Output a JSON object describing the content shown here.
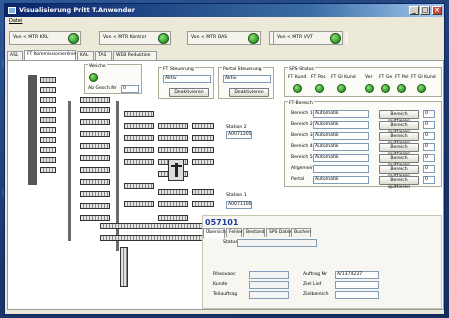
{
  "window": {
    "title": "Visualisierung Pritt T.Anwender",
    "menu_label": "Datei",
    "minimize_glyph": "_",
    "maximize_glyph": "□",
    "close_glyph": "×"
  },
  "status_strip": [
    {
      "label": "Von < MTR KRL"
    },
    {
      "label": "Von < MTR Kontrol"
    },
    {
      "label": "Von < MTR DAS"
    },
    {
      "label": "Von < MTR TDA"
    },
    {
      "label": "Von < MTR VVT"
    }
  ],
  "tabs": [
    {
      "label": "ASL",
      "active": false
    },
    {
      "label": "FT Kommissionierlinie",
      "active": true
    },
    {
      "label": "KAL",
      "active": false
    },
    {
      "label": "TAS",
      "active": false
    },
    {
      "label": "WEB Reduktion",
      "active": false
    }
  ],
  "weiche": {
    "title": "Weiche",
    "label": "Ab Gesch.Nr",
    "value": "0"
  },
  "ft_steuerung": {
    "title": "FT Steuerung",
    "field": "Aktiv",
    "button": "Deaktivieren"
  },
  "portal_steuerung": {
    "title": "Portal Steuerung",
    "field": "Aktiv",
    "button": "Deaktivieren"
  },
  "sps_status": {
    "title": "SPS-Status",
    "items": [
      "FT Kund",
      "FT Pos",
      "FT Gl Kund",
      "Ver",
      "FT Ge",
      "FT Pel",
      "FT Gl Kund"
    ]
  },
  "ft_bereich": {
    "title": "FT-Bereich",
    "rows": [
      {
        "label": "Bereich 1",
        "mode": "Automatik",
        "button": "Bereich quittieren",
        "value": "0"
      },
      {
        "label": "Bereich 2",
        "mode": "Automatik",
        "button": "Bereich quittieren",
        "value": "0"
      },
      {
        "label": "Bereich 3",
        "mode": "Automatik",
        "button": "Bereich quittieren",
        "value": "0"
      },
      {
        "label": "Bereich 4",
        "mode": "Automatik",
        "button": "Bereich quittieren",
        "value": "0"
      },
      {
        "label": "Bereich 5",
        "mode": "Automatik",
        "button": "Bereich quittieren",
        "value": "0"
      },
      {
        "label": "Allgemein",
        "mode": "",
        "button": "Bereich quittieren",
        "value": "0"
      },
      {
        "label": "Portal",
        "mode": "Automatik",
        "button": "Bereich quittieren",
        "value": "0"
      }
    ]
  },
  "stations": [
    {
      "label": "Station 2",
      "value": "A0071205"
    },
    {
      "label": "Station 1",
      "value": "A0071100"
    }
  ],
  "detail": {
    "order_number": "057101",
    "tabs": [
      "Übersicht",
      "Fehler",
      "Bestand",
      "SPS Daten",
      "Buchen"
    ],
    "status_label": "Status",
    "fields_left": [
      {
        "label": "Rheovaoc",
        "value": ""
      },
      {
        "label": "Kunde",
        "value": ""
      },
      {
        "label": "Teilauftrag",
        "value": ""
      }
    ],
    "fields_right": [
      {
        "label": "Auftrag Nr",
        "value": "A/1374237"
      },
      {
        "label": "Ziel Lief",
        "value": ""
      },
      {
        "label": "Zielbereich",
        "value": ""
      }
    ]
  },
  "colors": {
    "led_green": "#2f9a27",
    "title_blue": "#0a246a",
    "order_blue": "#1e3fa0"
  }
}
